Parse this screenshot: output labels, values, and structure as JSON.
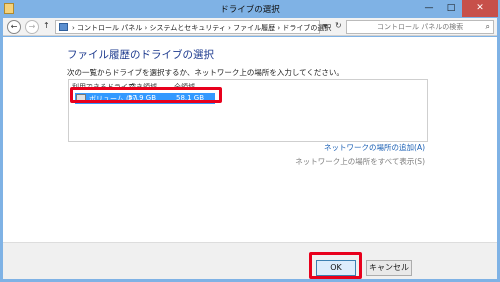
{
  "window": {
    "title": "ドライブの選択",
    "minimize_glyph": "—",
    "maximize_glyph": "□",
    "close_glyph": "✕"
  },
  "nav": {
    "back_glyph": "←",
    "forward_glyph": "→",
    "up_glyph": "↑",
    "breadcrumb": "›  コントロール パネル  ›  システムとセキュリティ  ›  ファイル履歴  ›  ドライブの選択",
    "dropdown_glyph": "▼",
    "refresh_glyph": "↻",
    "search_placeholder": "コントロール パネルの検索",
    "search_icon_glyph": "⌕"
  },
  "main": {
    "heading": "ファイル履歴のドライブの選択",
    "description": "次の一覧からドライブを選択するか、ネットワーク上の場所を入力してください。",
    "columns": [
      "利用できるドライブ",
      "空き領域",
      "全領域"
    ],
    "drives": [
      {
        "name": "ボリューム (F:)",
        "free": "57.9 GB",
        "total": "58.1 GB",
        "selected": true
      }
    ],
    "add_network_link": "ネットワークの場所の追加(A)",
    "show_all_network_link": "ネットワーク上の場所をすべて表示(S)"
  },
  "footer": {
    "ok_label": "OK",
    "cancel_label": "キャンセル"
  },
  "colors": {
    "title_bar": "#7fb2e5",
    "selection": "#3399ff",
    "highlight_box": "#e8001c",
    "heading": "#1e3b8f",
    "link": "#1a5fb4"
  }
}
